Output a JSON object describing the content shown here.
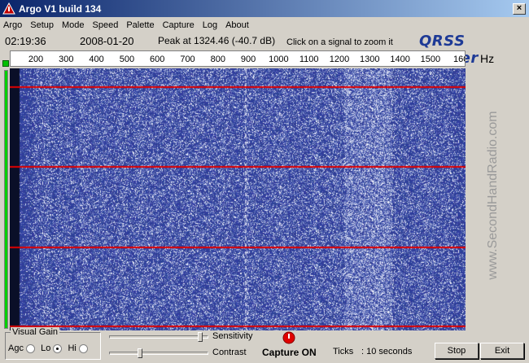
{
  "window": {
    "title": "Argo V1 build 134",
    "close_glyph": "×"
  },
  "menu": [
    "Argo",
    "Setup",
    "Mode",
    "Speed",
    "Palette",
    "Capture",
    "Log",
    "About"
  ],
  "info": {
    "time": "02:19:36",
    "date": "2008-01-20",
    "peak": "Peak at 1324.46 (-40.7 dB)",
    "hint": "Click on a signal to zoom it",
    "brand": "QRSS Viewer"
  },
  "scale": {
    "ticks": [
      "200",
      "300",
      "400",
      "500",
      "600",
      "700",
      "800",
      "900",
      "1000",
      "1100",
      "1200",
      "1300",
      "1400",
      "1500",
      "160"
    ],
    "unit": "Hz"
  },
  "watermark": "www.SecondHandRadio.com",
  "controls": {
    "visual_gain_label": "Visual Gain",
    "agc_label": "Agc",
    "lo_label": "Lo",
    "hi_label": "Hi",
    "selected_gain": "Lo",
    "sensitivity_label": "Sensitivity",
    "sensitivity_level": 0.95,
    "contrast_label": "Contrast",
    "contrast_level": 0.3,
    "capture_status": "Capture ON",
    "ticks_label": "Ticks",
    "ticks_value": ": 10 seconds",
    "stop_button": "Stop",
    "exit_button": "Exit"
  },
  "colors": {
    "waterfall_bg": "#3f4d9e",
    "time_marker": "#e00000",
    "capture_indicator": "#e00000"
  }
}
